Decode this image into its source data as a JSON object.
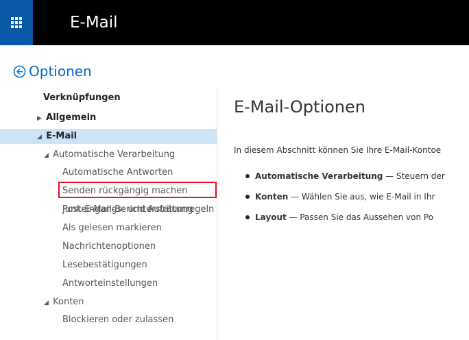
{
  "app": {
    "title": "E-Mail"
  },
  "header": {
    "back_label": "Optionen"
  },
  "sidebar": {
    "items": [
      {
        "label": "Verknüpfungen"
      },
      {
        "label": "Allgemein"
      },
      {
        "label": "E-Mail"
      },
      {
        "label": "Automatische Verarbeitung"
      },
      {
        "label": "Automatische Antworten"
      },
      {
        "label": "Senden rückgängig machen"
      },
      {
        "label": "Posteingangs- und Aufräumregeln"
      },
      {
        "label": "Junk-E-Mail-Berichterstattung"
      },
      {
        "label": "Als gelesen markieren"
      },
      {
        "label": "Nachrichtenoptionen"
      },
      {
        "label": "Lesebestätigungen"
      },
      {
        "label": "Antworteinstellungen"
      },
      {
        "label": "Konten"
      },
      {
        "label": "Blockieren oder zulassen"
      }
    ]
  },
  "main": {
    "title": "E-Mail-Optionen",
    "intro": "In diesem Abschnitt können Sie Ihre E-Mail-Kontoe",
    "bullets": [
      {
        "term": "Automatische Verarbeitung",
        "text": " — Steuern der"
      },
      {
        "term": "Konten",
        "text": " — Wählen Sie aus, wie E-Mail in Ihr"
      },
      {
        "term": "Layout",
        "text": " — Passen Sie das Aussehen von Po"
      }
    ]
  },
  "colors": {
    "topbar": "#000000",
    "waffle_bg": "#0a58a8",
    "accent": "#0a65c2",
    "selected_bg": "#cde3f7",
    "highlight_border": "#e81123"
  }
}
